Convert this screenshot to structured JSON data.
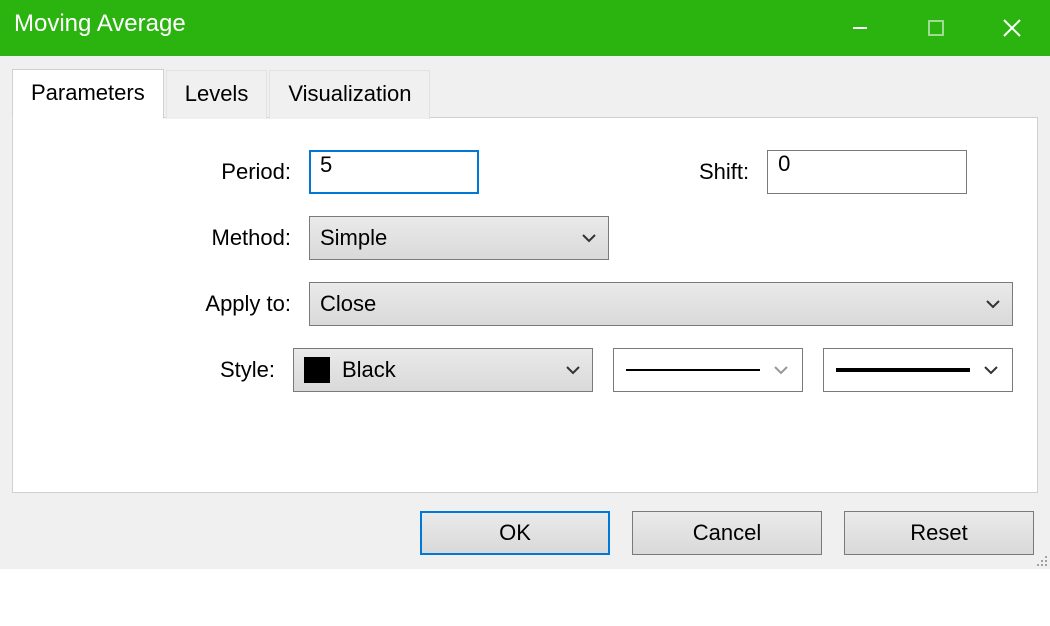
{
  "window": {
    "title": "Moving Average"
  },
  "tabs": [
    {
      "label": "Parameters",
      "active": true
    },
    {
      "label": "Levels",
      "active": false
    },
    {
      "label": "Visualization",
      "active": false
    }
  ],
  "labels": {
    "period": "Period:",
    "shift": "Shift:",
    "method": "Method:",
    "apply_to": "Apply to:",
    "style": "Style:"
  },
  "values": {
    "period": "5",
    "shift": "0",
    "method": "Simple",
    "apply_to": "Close",
    "style_color_name": "Black",
    "style_color_hex": "#000000",
    "style_line_type": "solid-thin",
    "style_line_width": "solid-thick"
  },
  "buttons": {
    "ok": "OK",
    "cancel": "Cancel",
    "reset": "Reset"
  }
}
